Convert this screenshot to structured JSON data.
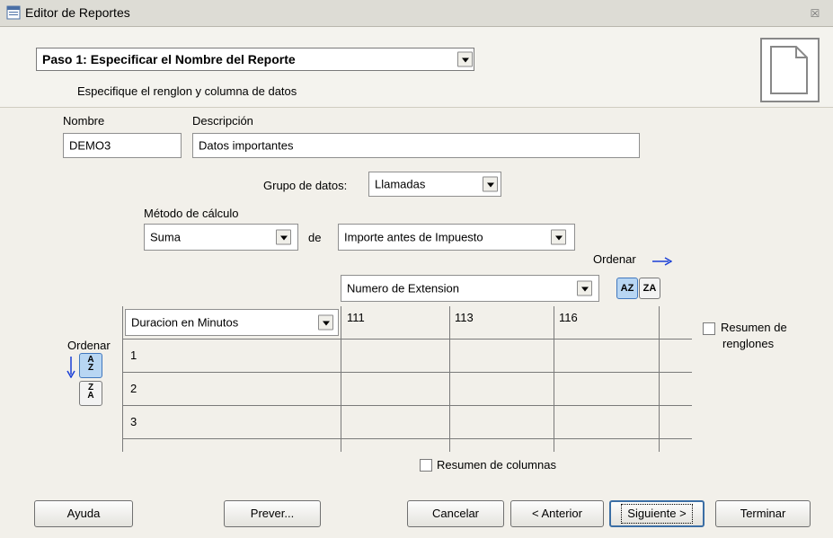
{
  "window": {
    "title": "Editor de Reportes",
    "close_glyph": "☒",
    "icon": "window-app-icon"
  },
  "header": {
    "step_combo_value": "Paso 1: Especificar el Nombre del Reporte",
    "subtitle": "Especifique el renglon y columna de datos",
    "doc_icon": "document-icon"
  },
  "form": {
    "nombre_label": "Nombre",
    "nombre_value": "DEMO3",
    "descripcion_label": "Descripción",
    "descripcion_value": "Datos importantes",
    "grupo_label": "Grupo de datos:",
    "grupo_value": "Llamadas",
    "metodo_label": "Método de cálculo",
    "metodo_value": "Suma",
    "de_label": "de",
    "importe_value": "Importe antes de Impuesto",
    "ordenar_col_label": "Ordenar",
    "column_field_value": "Numero de Extension",
    "sort_az_label": "AZ",
    "sort_za_label": "ZA",
    "ordenar_row_label": "Ordenar",
    "row_field_value": "Duracion en Minutos",
    "row_sort_az_top": "A",
    "row_sort_az_bottom": "Z",
    "row_sort_za_top": "Z",
    "row_sort_za_bottom": "A"
  },
  "table": {
    "column_headers": [
      "111",
      "113",
      "116"
    ],
    "row_headers": [
      "1",
      "2",
      "3"
    ]
  },
  "options": {
    "resumen_renglones_line1": "Resumen de",
    "resumen_renglones_line2": "renglones",
    "resumen_renglones_checked": false,
    "resumen_columnas": "Resumen de columnas",
    "resumen_columnas_checked": false
  },
  "footer": {
    "ayuda": "Ayuda",
    "prever": "Prever...",
    "cancelar": "Cancelar",
    "anterior": "< Anterior",
    "siguiente": "Siguiente >",
    "terminar": "Terminar"
  },
  "colors": {
    "accent": "#1a3fd6",
    "active_sort": "#b8d6f3"
  }
}
